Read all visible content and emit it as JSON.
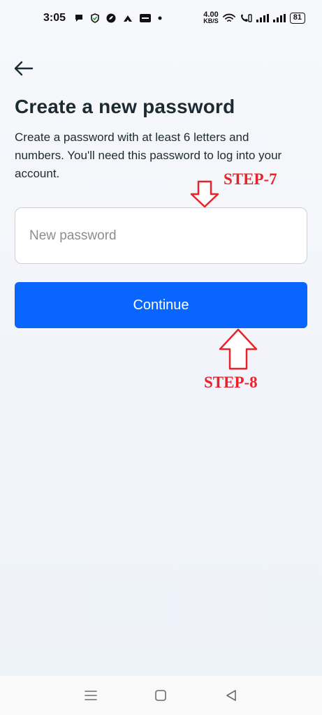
{
  "status_bar": {
    "time": "3:05",
    "net_speed_value": "4.00",
    "net_speed_unit": "KB/S",
    "battery": "81"
  },
  "page": {
    "title": "Create a new password",
    "subtitle": "Create a password with at least 6 letters and numbers. You'll need this password to log into your account."
  },
  "form": {
    "password_placeholder": "New password",
    "password_value": "",
    "continue_label": "Continue"
  },
  "annotations": {
    "step7": "STEP-7",
    "step8": "STEP-8",
    "color": "#e8232a"
  },
  "colors": {
    "primary_button": "#0866ff",
    "text": "#1c2b33"
  },
  "icons": {
    "back": "back-arrow-icon",
    "nav_menu": "menu-icon",
    "nav_home": "home-icon",
    "nav_back": "back-triangle-icon"
  }
}
